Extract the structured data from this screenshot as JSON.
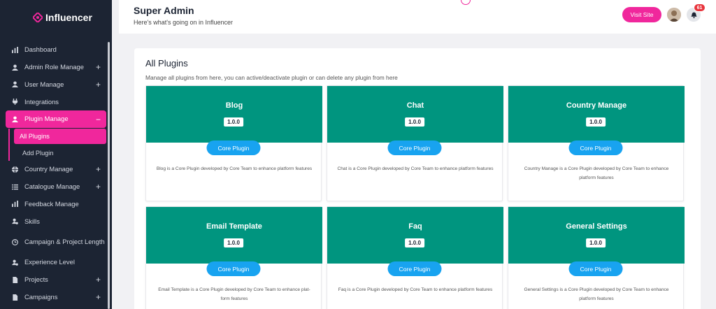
{
  "brand": {
    "name": "Influencer"
  },
  "sidebar": {
    "items": [
      {
        "label": "Dashboard",
        "icon": "bar-chart-icon",
        "expandable": false
      },
      {
        "label": "Admin Role Manage",
        "icon": "user-icon",
        "expandable": true
      },
      {
        "label": "User Manage",
        "icon": "user-icon",
        "expandable": true
      },
      {
        "label": "Integrations",
        "icon": "plug-icon",
        "expandable": false
      },
      {
        "label": "Plugin Manage",
        "icon": "user-icon",
        "expandable": true,
        "active": true,
        "toggle": "−"
      },
      {
        "label": "Country Manage",
        "icon": "globe-icon",
        "expandable": true
      },
      {
        "label": "Catalogue Manage",
        "icon": "list-icon",
        "expandable": true
      },
      {
        "label": "Feedback Manage",
        "icon": "bar-chart-icon",
        "expandable": false
      },
      {
        "label": "Skills",
        "icon": "user-gear-icon",
        "expandable": false
      },
      {
        "label": "Campaign & Project Length",
        "icon": "clock-icon",
        "expandable": false
      },
      {
        "label": "Experience Level",
        "icon": "user-gear-icon",
        "expandable": false
      },
      {
        "label": "Projects",
        "icon": "file-icon",
        "expandable": true
      },
      {
        "label": "Campaigns",
        "icon": "file-icon",
        "expandable": true
      }
    ],
    "plugin_sub": [
      {
        "label": "All Plugins",
        "active": true
      },
      {
        "label": "Add Plugin",
        "active": false
      }
    ],
    "plus_symbol": "+"
  },
  "header": {
    "title": "Super Admin",
    "subtitle": "Here's what's going on in Influencer",
    "visit_site": "Visit Site",
    "notification_count": "61"
  },
  "main": {
    "title": "All Plugins",
    "description": "Manage all plugins from here, you can active/deactivate plugin or can delete any plugin from here",
    "plugins": [
      {
        "name": "Blog",
        "version": "1.0.0",
        "tag": "Core Plugin",
        "desc": "Blog is a Core Plugin developed by Core Team to enhance platform features"
      },
      {
        "name": "Chat",
        "version": "1.0.0",
        "tag": "Core Plugin",
        "desc": "Chat is a Core Plugin developed by Core Team to enhance platform features"
      },
      {
        "name": "Country Manage",
        "version": "1.0.0",
        "tag": "Core Plugin",
        "desc": "Country Manage is a Core Plugin developed by Core Team to enhance platform features"
      },
      {
        "name": "Email Template",
        "version": "1.0.0",
        "tag": "Core Plugin",
        "desc": "Email Template is a Core Plugin developed by Core Team to enhance plat-form features"
      },
      {
        "name": "Faq",
        "version": "1.0.0",
        "tag": "Core Plugin",
        "desc": "Faq is a Core Plugin developed by Core Team to enhance platform features"
      },
      {
        "name": "General Settings",
        "version": "1.0.0",
        "tag": "Core Plugin",
        "desc": "General Settings is a Core Plugin developed by Core Team to enhance platform features"
      }
    ]
  },
  "colors": {
    "sidebar_bg": "#1c2433",
    "accent_pink": "#f0279c",
    "plugin_header": "#00957f",
    "core_button": "#18a3f0",
    "badge_red": "#e8343c"
  }
}
